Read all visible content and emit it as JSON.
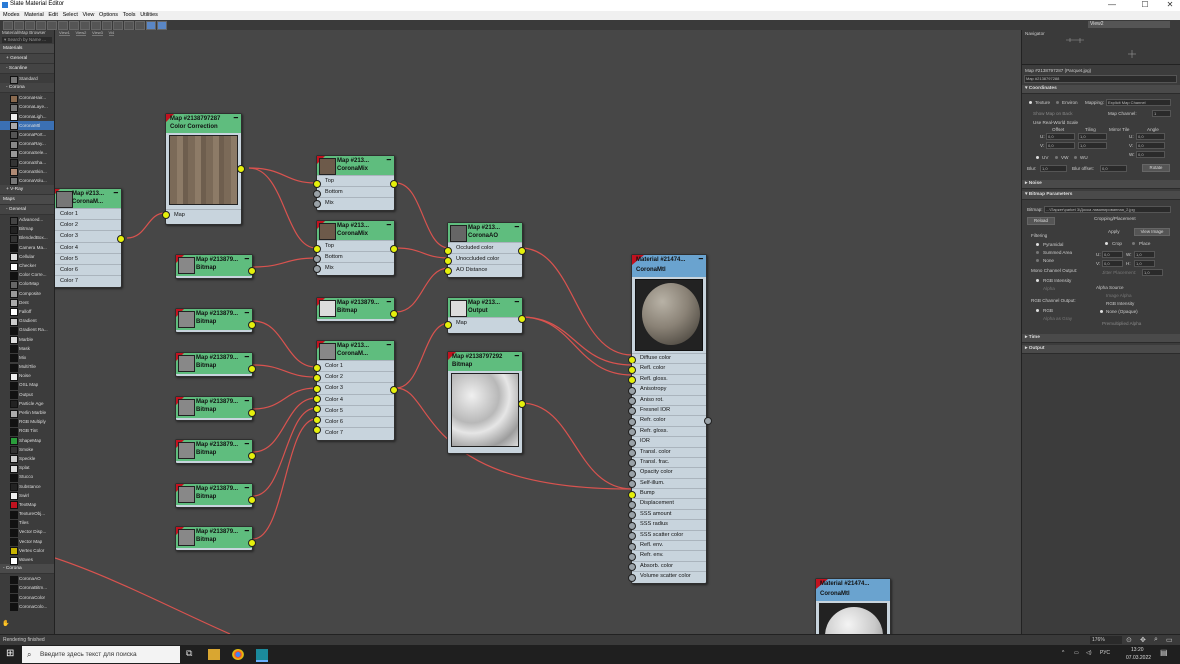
{
  "window": {
    "title": "Slate Material Editor",
    "min": "—",
    "max": "☐",
    "close": "✕"
  },
  "menu": [
    "Modes",
    "Material",
    "Edit",
    "Select",
    "View",
    "Options",
    "Tools",
    "Utilities"
  ],
  "toolbar": {
    "view_select": "View2"
  },
  "browser": {
    "title": "Material/Map Browser",
    "search_placeholder": "▾ Search by Name ...",
    "items": [
      {
        "kind": "cat",
        "label": "Materials"
      },
      {
        "kind": "sub",
        "label": "+ General"
      },
      {
        "kind": "sub",
        "label": "- Scanline"
      },
      {
        "kind": "item",
        "label": "Standard",
        "color": "#777777"
      },
      {
        "kind": "sub",
        "label": "- Corona"
      },
      {
        "kind": "item",
        "label": "CoronaHair...",
        "color": "#8a6a4f"
      },
      {
        "kind": "item",
        "label": "CoronaLaye...",
        "color": "#777777"
      },
      {
        "kind": "item",
        "label": "CoronaLigh...",
        "color": "#eeeeee"
      },
      {
        "kind": "item",
        "label": "CoronaMtl",
        "color": "#a9a9a9",
        "selected": true
      },
      {
        "kind": "item",
        "label": "CoronaPort...",
        "color": "#555555"
      },
      {
        "kind": "item",
        "label": "CoronaRay...",
        "color": "#888888"
      },
      {
        "kind": "item",
        "label": "CoronaSele...",
        "color": "#999999"
      },
      {
        "kind": "item",
        "label": "CoronaSha...",
        "color": "#333333"
      },
      {
        "kind": "item",
        "label": "CoronaSkin...",
        "color": "#b08a74"
      },
      {
        "kind": "item",
        "label": "CoronaVolu...",
        "color": "#777777"
      },
      {
        "kind": "sub",
        "label": "+ V-Ray"
      },
      {
        "kind": "cat",
        "label": "Maps"
      },
      {
        "kind": "sub",
        "label": "- General"
      },
      {
        "kind": "item",
        "label": "Advanced...",
        "color": "#444444"
      },
      {
        "kind": "item",
        "label": "Bitmap",
        "color": "#222222"
      },
      {
        "kind": "item",
        "label": "BlendedBox...",
        "color": "#333333"
      },
      {
        "kind": "item",
        "label": "Camera Ma...",
        "color": "#111111"
      },
      {
        "kind": "item",
        "label": "Cellular",
        "color": "#dddddd"
      },
      {
        "kind": "item",
        "label": "Checker",
        "color": "#ffffff"
      },
      {
        "kind": "item",
        "label": "Color Corre...",
        "color": "#111111"
      },
      {
        "kind": "item",
        "label": "ColorMap",
        "color": "#666666"
      },
      {
        "kind": "item",
        "label": "Composite",
        "color": "#999999"
      },
      {
        "kind": "item",
        "label": "Dent",
        "color": "#aaaaaa"
      },
      {
        "kind": "item",
        "label": "Falloff",
        "color": "#ffffff"
      },
      {
        "kind": "item",
        "label": "Gradient",
        "color": "#cccccc"
      },
      {
        "kind": "item",
        "label": "Gradient Ra...",
        "color": "#111111"
      },
      {
        "kind": "item",
        "label": "Marble",
        "color": "#dddddd"
      },
      {
        "kind": "item",
        "label": "Mask",
        "color": "#111111"
      },
      {
        "kind": "item",
        "label": "Mix",
        "color": "#111111"
      },
      {
        "kind": "item",
        "label": "MultiTile",
        "color": "#111111"
      },
      {
        "kind": "item",
        "label": "Noise",
        "color": "#eeeeee"
      },
      {
        "kind": "item",
        "label": "OSL Map",
        "color": "#111111"
      },
      {
        "kind": "item",
        "label": "Output",
        "color": "#111111"
      },
      {
        "kind": "item",
        "label": "Particle Age",
        "color": "#222222"
      },
      {
        "kind": "item",
        "label": "Perlin Marble",
        "color": "#aaaaaa"
      },
      {
        "kind": "item",
        "label": "RGB Multiply",
        "color": "#111111"
      },
      {
        "kind": "item",
        "label": "RGB Tint",
        "color": "#111111"
      },
      {
        "kind": "item",
        "label": "ShapeMap",
        "color": "#2a9d3b"
      },
      {
        "kind": "item",
        "label": "Smoke",
        "color": "#333333"
      },
      {
        "kind": "item",
        "label": "Speckle",
        "color": "#cccccc"
      },
      {
        "kind": "item",
        "label": "Splat",
        "color": "#dddddd"
      },
      {
        "kind": "item",
        "label": "Stucco",
        "color": "#111111"
      },
      {
        "kind": "item",
        "label": "Substance",
        "color": "#222222"
      },
      {
        "kind": "item",
        "label": "Swirl",
        "color": "#eeeeee"
      },
      {
        "kind": "item",
        "label": "TextMap",
        "color": "#c1121f"
      },
      {
        "kind": "item",
        "label": "TextureObj...",
        "color": "#111111"
      },
      {
        "kind": "item",
        "label": "Tiles",
        "color": "#111111"
      },
      {
        "kind": "item",
        "label": "Vector Disp...",
        "color": "#111111"
      },
      {
        "kind": "item",
        "label": "Vector Map",
        "color": "#111111"
      },
      {
        "kind": "item",
        "label": "Vertex Color",
        "color": "#c8b400"
      },
      {
        "kind": "item",
        "label": "Waves",
        "color": "#ffffff"
      },
      {
        "kind": "cat",
        "label": "- Corona"
      },
      {
        "kind": "item",
        "label": "CoronaAO",
        "color": "#111111"
      },
      {
        "kind": "item",
        "label": "CoronaBitm...",
        "color": "#111111"
      },
      {
        "kind": "item",
        "label": "CoronaColor",
        "color": "#111111"
      },
      {
        "kind": "item",
        "label": "CoronaColo...",
        "color": "#111111"
      }
    ]
  },
  "view_tabs": [
    "View1",
    "View2",
    "View3",
    "Vi4"
  ],
  "nodes": {
    "left_partial": {
      "title": "Map #213...",
      "subtitle": "CoronaM...",
      "slots": [
        "Color 1",
        "Color 2",
        "Color 3",
        "Color 4",
        "Color 5",
        "Color 6",
        "Color 7"
      ]
    },
    "color_correction": {
      "title": "Map #2138797287",
      "subtitle": "Color Correction",
      "slots": [
        "Map"
      ]
    },
    "mix1": {
      "title": "Map #213...",
      "subtitle": "CoronaMix",
      "slots": [
        "Top",
        "Bottom",
        "Mix"
      ]
    },
    "mix2": {
      "title": "Map #213...",
      "subtitle": "CoronaMix",
      "slots": [
        "Top",
        "Bottom",
        "Mix"
      ]
    },
    "ao": {
      "title": "Map #213...",
      "subtitle": "CoronaAO",
      "slots": [
        "Occluded color",
        "Unoccluded color",
        "AO Distance"
      ]
    },
    "bitmap_mid": {
      "title": "Map #213879...",
      "subtitle": "Bitmap"
    },
    "output": {
      "title": "Map #213...",
      "subtitle": "Output",
      "slots": [
        "Map"
      ]
    },
    "multimap": {
      "title": "Map #213...",
      "subtitle": "CoronaM...",
      "slots": [
        "Color 1",
        "Color 2",
        "Color 3",
        "Color 4",
        "Color 5",
        "Color 6",
        "Color 7"
      ]
    },
    "bitmap_big": {
      "title": "Map #2138797292",
      "subtitle": "Bitmap"
    },
    "bitmaps": [
      {
        "title": "Map #213879...",
        "subtitle": "Bitmap"
      },
      {
        "title": "Map #213879...",
        "subtitle": "Bitmap"
      },
      {
        "title": "Map #213879...",
        "subtitle": "Bitmap"
      },
      {
        "title": "Map #213879...",
        "subtitle": "Bitmap"
      },
      {
        "title": "Map #213879...",
        "subtitle": "Bitmap"
      },
      {
        "title": "Map #213879...",
        "subtitle": "Bitmap"
      },
      {
        "title": "Map #213879...",
        "subtitle": "Bitmap"
      }
    ],
    "material": {
      "title": "Material #21474...",
      "subtitle": "CoronaMtl",
      "slots": [
        "Diffuse color",
        "Refl. color",
        "Refl. gloss.",
        "Anisotropy",
        "Aniso rot.",
        "Fresnel IOR",
        "Refr. color",
        "Refr. gloss.",
        "IOR",
        "Transl. color",
        "Transl. frac.",
        "Opacity color",
        "Self-illum.",
        "Bump",
        "Displacement",
        "SSS amount",
        "SSS radius",
        "SSS scatter color",
        "Refl. env.",
        "Refr. env.",
        "Absorb. color",
        "Volume scatter color"
      ]
    },
    "material2": {
      "title": "Material #21474...",
      "subtitle": "CoronaMtl"
    }
  },
  "right_panel": {
    "navigator_title": "Navigator",
    "map_name_label": "Map #2138797287 (Parquet.jpg)",
    "map_name_field": "Map #2138797288",
    "coordinates": {
      "title": "Coordinates",
      "texture": "Texture",
      "environ": "Environ",
      "mapping_label": "Mapping:",
      "mapping_value": "Explicit Map Channel",
      "show_back": "Show Map on Back",
      "map_channel_label": "Map Channel:",
      "map_channel_value": "1",
      "real_world": "Use Real-World Scale",
      "col_offset": "Offset",
      "col_tiling": "Tiling",
      "col_mirror": "Mirror Tile",
      "col_angle": "Angle",
      "u_label": "U:",
      "v_label": "V:",
      "w_label": "W:",
      "u_offset": "0,0",
      "v_offset": "0,0",
      "u_tiling": "1,0",
      "v_tiling": "1,0",
      "u_angle": "0,0",
      "v_angle": "0,0",
      "w_angle": "0,0",
      "uv": "UV",
      "vw": "VW",
      "wu": "WU",
      "blur_label": "Blur:",
      "blur_value": "1,0",
      "blur_offset_label": "Blur offset:",
      "blur_offset_value": "0,0",
      "rotate": "Rotate"
    },
    "noise": "Noise",
    "bitmap_params": {
      "title": "Bitmap Parameters",
      "bitmap_label": "Bitmap:",
      "bitmap_path": "...\\Паркет\\parket 3\\Доска ламинированная_2.jpg",
      "reload": "Reload",
      "cropping": "Cropping/Placement",
      "apply": "Apply",
      "view_image": "View Image",
      "filtering": "Filtering",
      "pyramidal": "Pyramidal",
      "summed_area": "Summed Area",
      "none": "None",
      "crop": "Crop",
      "place": "Place",
      "u_val": "0,0",
      "w_val": "1,0",
      "v_val": "0,0",
      "h_val": "1,0",
      "jitter": "Jitter Placement:",
      "jitter_val": "1,0",
      "mono_title": "Mono Channel Output:",
      "rgb_intensity": "RGB Intensity",
      "alpha": "Alpha",
      "rgb_title": "RGB Channel Output:",
      "rgb": "RGB",
      "alpha_as_gray": "Alpha as Gray",
      "alpha_source": "Alpha Source",
      "image_alpha": "Image Alpha",
      "rgb_intensity2": "RGB Intensity",
      "none_opaque": "None (Opaque)",
      "premult": "Premultiplied Alpha"
    },
    "time": "Time",
    "output": "Output"
  },
  "status": {
    "text": "Rendering finished",
    "zoom": "176%"
  },
  "taskbar": {
    "search_placeholder": "Введите здесь текст для поиска",
    "lang": "РУС",
    "time": "13:20",
    "date": "07.03.2022"
  }
}
